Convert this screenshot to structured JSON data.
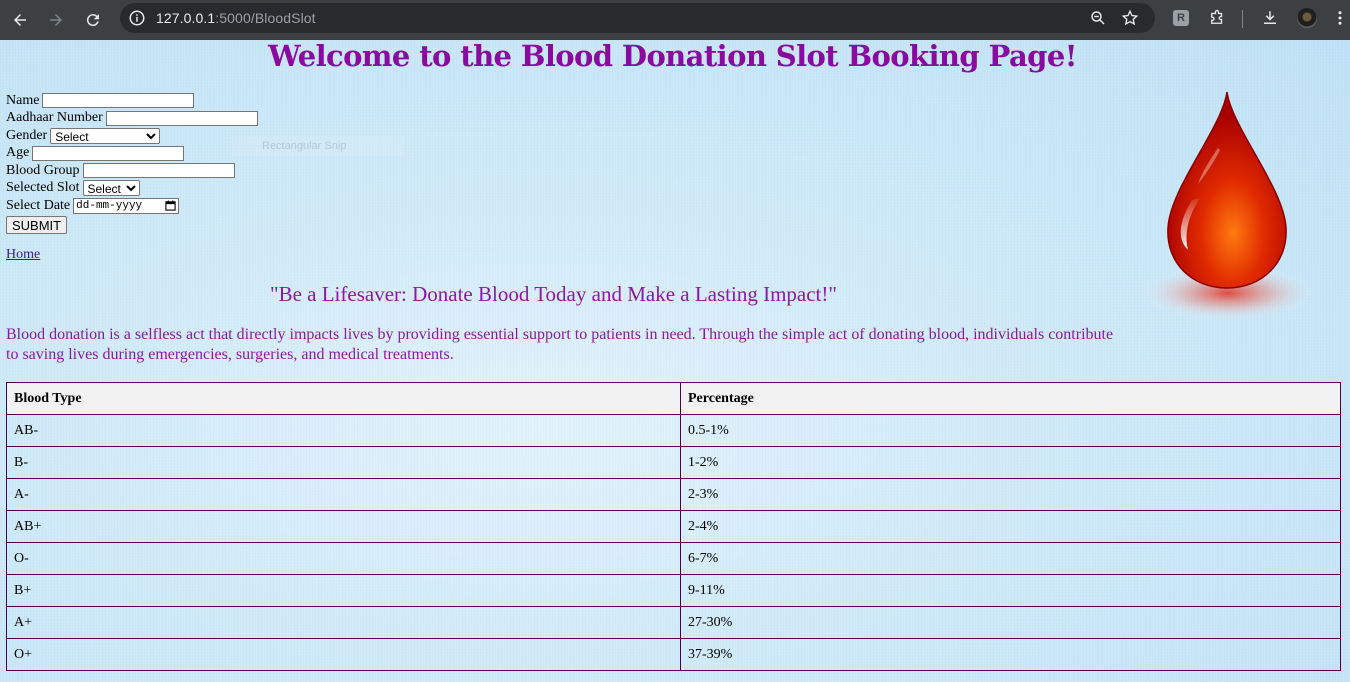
{
  "browser": {
    "url_host": "127.0.0.1",
    "url_path": ":5000/BloodSlot",
    "extension_letter": "R"
  },
  "page": {
    "title": "Welcome to the Blood Donation Slot Booking Page!",
    "form": {
      "name_label": "Name",
      "aadhaar_label": "Aadhaar Number",
      "gender_label": "Gender",
      "gender_value": "Select",
      "age_label": "Age",
      "blood_group_label": "Blood Group",
      "slot_label": "Selected Slot",
      "slot_value": "Select",
      "date_label": "Select Date",
      "date_placeholder": "dd-mm-yyyy",
      "submit_label": "SUBMIT"
    },
    "ghost_text": "Rectangular Snip",
    "home_link": "Home",
    "quote": "\"Be a Lifesaver: Donate Blood Today and Make a Lasting Impact!\"",
    "paragraph": "Blood donation is a selfless act that directly impacts lives by providing essential support to patients in need. Through the simple act of donating blood, individuals contribute to saving lives during emergencies, surgeries, and medical treatments.",
    "table": {
      "headers": [
        "Blood Type",
        "Percentage"
      ],
      "rows": [
        [
          "AB-",
          "0.5-1%"
        ],
        [
          "B-",
          "1-2%"
        ],
        [
          "A-",
          "2-3%"
        ],
        [
          "AB+",
          "2-4%"
        ],
        [
          "O-",
          "6-7%"
        ],
        [
          "B+",
          "9-11%"
        ],
        [
          "A+",
          "27-30%"
        ],
        [
          "O+",
          "37-39%"
        ]
      ]
    }
  },
  "colors": {
    "title": "#8a0aa0",
    "text_accent": "#8a1aa0",
    "table_border": "#4a0050",
    "page_background": "#c9e8f8"
  }
}
